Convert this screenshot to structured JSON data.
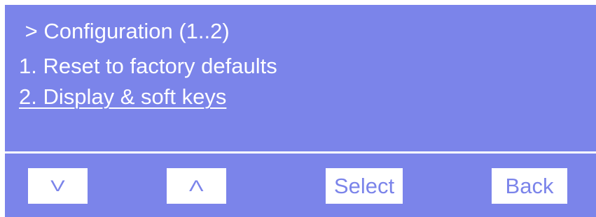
{
  "menu": {
    "title": " > Configuration (1..2)",
    "items": [
      {
        "label": "1. Reset to factory defaults",
        "selected": false
      },
      {
        "label": "2. Display & soft keys",
        "selected": true
      }
    ]
  },
  "softkeys": {
    "down_glyph": "V",
    "up_glyph": "Λ",
    "select_label": "Select",
    "back_label": "Back"
  },
  "colors": {
    "screen_background": "#7b84ea",
    "text": "#ffffff",
    "softkey_text": "#7b84ea"
  }
}
